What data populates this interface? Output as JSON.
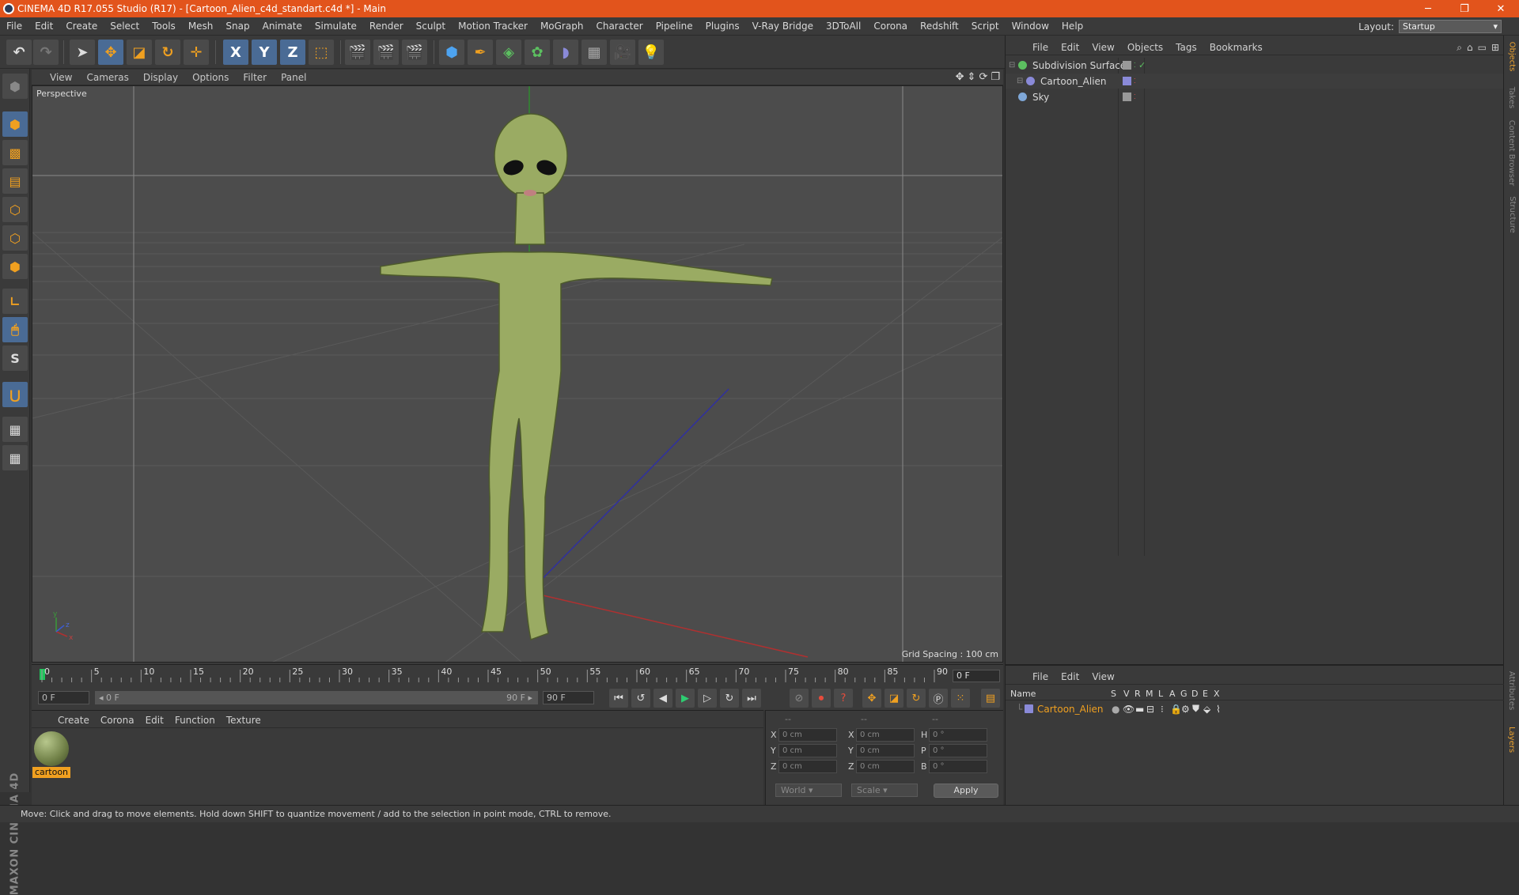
{
  "window": {
    "title": "CINEMA 4D R17.055 Studio (R17) - [Cartoon_Alien_c4d_standart.c4d *] - Main",
    "minimize": "─",
    "maximize": "❐",
    "close": "✕"
  },
  "menu": [
    "File",
    "Edit",
    "Create",
    "Select",
    "Tools",
    "Mesh",
    "Snap",
    "Animate",
    "Simulate",
    "Render",
    "Sculpt",
    "Motion Tracker",
    "MoGraph",
    "Character",
    "Pipeline",
    "Plugins",
    "V-Ray Bridge",
    "3DToAll",
    "Corona",
    "Redshift",
    "Script",
    "Window",
    "Help"
  ],
  "layout": {
    "label": "Layout:",
    "value": "Startup"
  },
  "toolbar": {
    "x_axis": "X",
    "y_axis": "Y",
    "z_axis": "Z"
  },
  "left_tools": {
    "snap_label": "S"
  },
  "viewport": {
    "menu": [
      "View",
      "Cameras",
      "Display",
      "Options",
      "Filter",
      "Panel"
    ],
    "camera_label": "Perspective",
    "grid_spacing": "Grid Spacing : 100 cm",
    "axis_x": "x",
    "axis_y": "y",
    "axis_z": "z"
  },
  "objects": {
    "menu": [
      "File",
      "Edit",
      "View",
      "Objects",
      "Tags",
      "Bookmarks"
    ],
    "items": [
      {
        "name": "Subdivision Surface",
        "icon_color": "#5cc060",
        "status": "✓"
      },
      {
        "name": "Cartoon_Alien",
        "icon_color": "#8a8ad8",
        "status": ""
      },
      {
        "name": "Sky",
        "icon_color": "#7fa8d8",
        "status": ""
      }
    ]
  },
  "right_tabs": [
    "Objects",
    "Takes",
    "Content Browser",
    "Structure"
  ],
  "right_tabs_bottom": [
    "Attributes",
    "Layers"
  ],
  "timeline": {
    "ticks": [
      "0",
      "5",
      "10",
      "15",
      "20",
      "25",
      "30",
      "35",
      "40",
      "45",
      "50",
      "55",
      "60",
      "65",
      "70",
      "75",
      "80",
      "85",
      "90"
    ],
    "current_frame": "0 F"
  },
  "transport": {
    "start_frame": "0 F",
    "range_start": "◂ 0 F",
    "range_end": "90 F ▸",
    "end_frame": "90 F"
  },
  "materials": {
    "menu": [
      "Create",
      "Corona",
      "Edit",
      "Function",
      "Texture"
    ],
    "items": [
      {
        "name": "cartoon"
      }
    ]
  },
  "coordinates": {
    "header": [
      "--",
      "--",
      "--"
    ],
    "rows": [
      {
        "l1": "X",
        "v1": "0 cm",
        "l2": "X",
        "v2": "0 cm",
        "l3": "H",
        "v3": "0 °"
      },
      {
        "l1": "Y",
        "v1": "0 cm",
        "l2": "Y",
        "v2": "0 cm",
        "l3": "P",
        "v3": "0 °"
      },
      {
        "l1": "Z",
        "v1": "0 cm",
        "l2": "Z",
        "v2": "0 cm",
        "l3": "B",
        "v3": "0 °"
      }
    ],
    "mode": "World",
    "type": "Scale",
    "apply": "Apply"
  },
  "layers": {
    "menu": [
      "File",
      "Edit",
      "View"
    ],
    "columns": [
      "Name",
      "S",
      "V",
      "R",
      "M",
      "L",
      "A",
      "G",
      "D",
      "E",
      "X"
    ],
    "items": [
      {
        "name": "Cartoon_Alien"
      }
    ]
  },
  "status": "Move: Click and drag to move elements. Hold down SHIFT to quantize movement / add to the selection in point mode, CTRL to remove.",
  "colors": {
    "accent": "#f0a020",
    "titlebar": "#e2541c",
    "selection": "#4a6b95"
  }
}
